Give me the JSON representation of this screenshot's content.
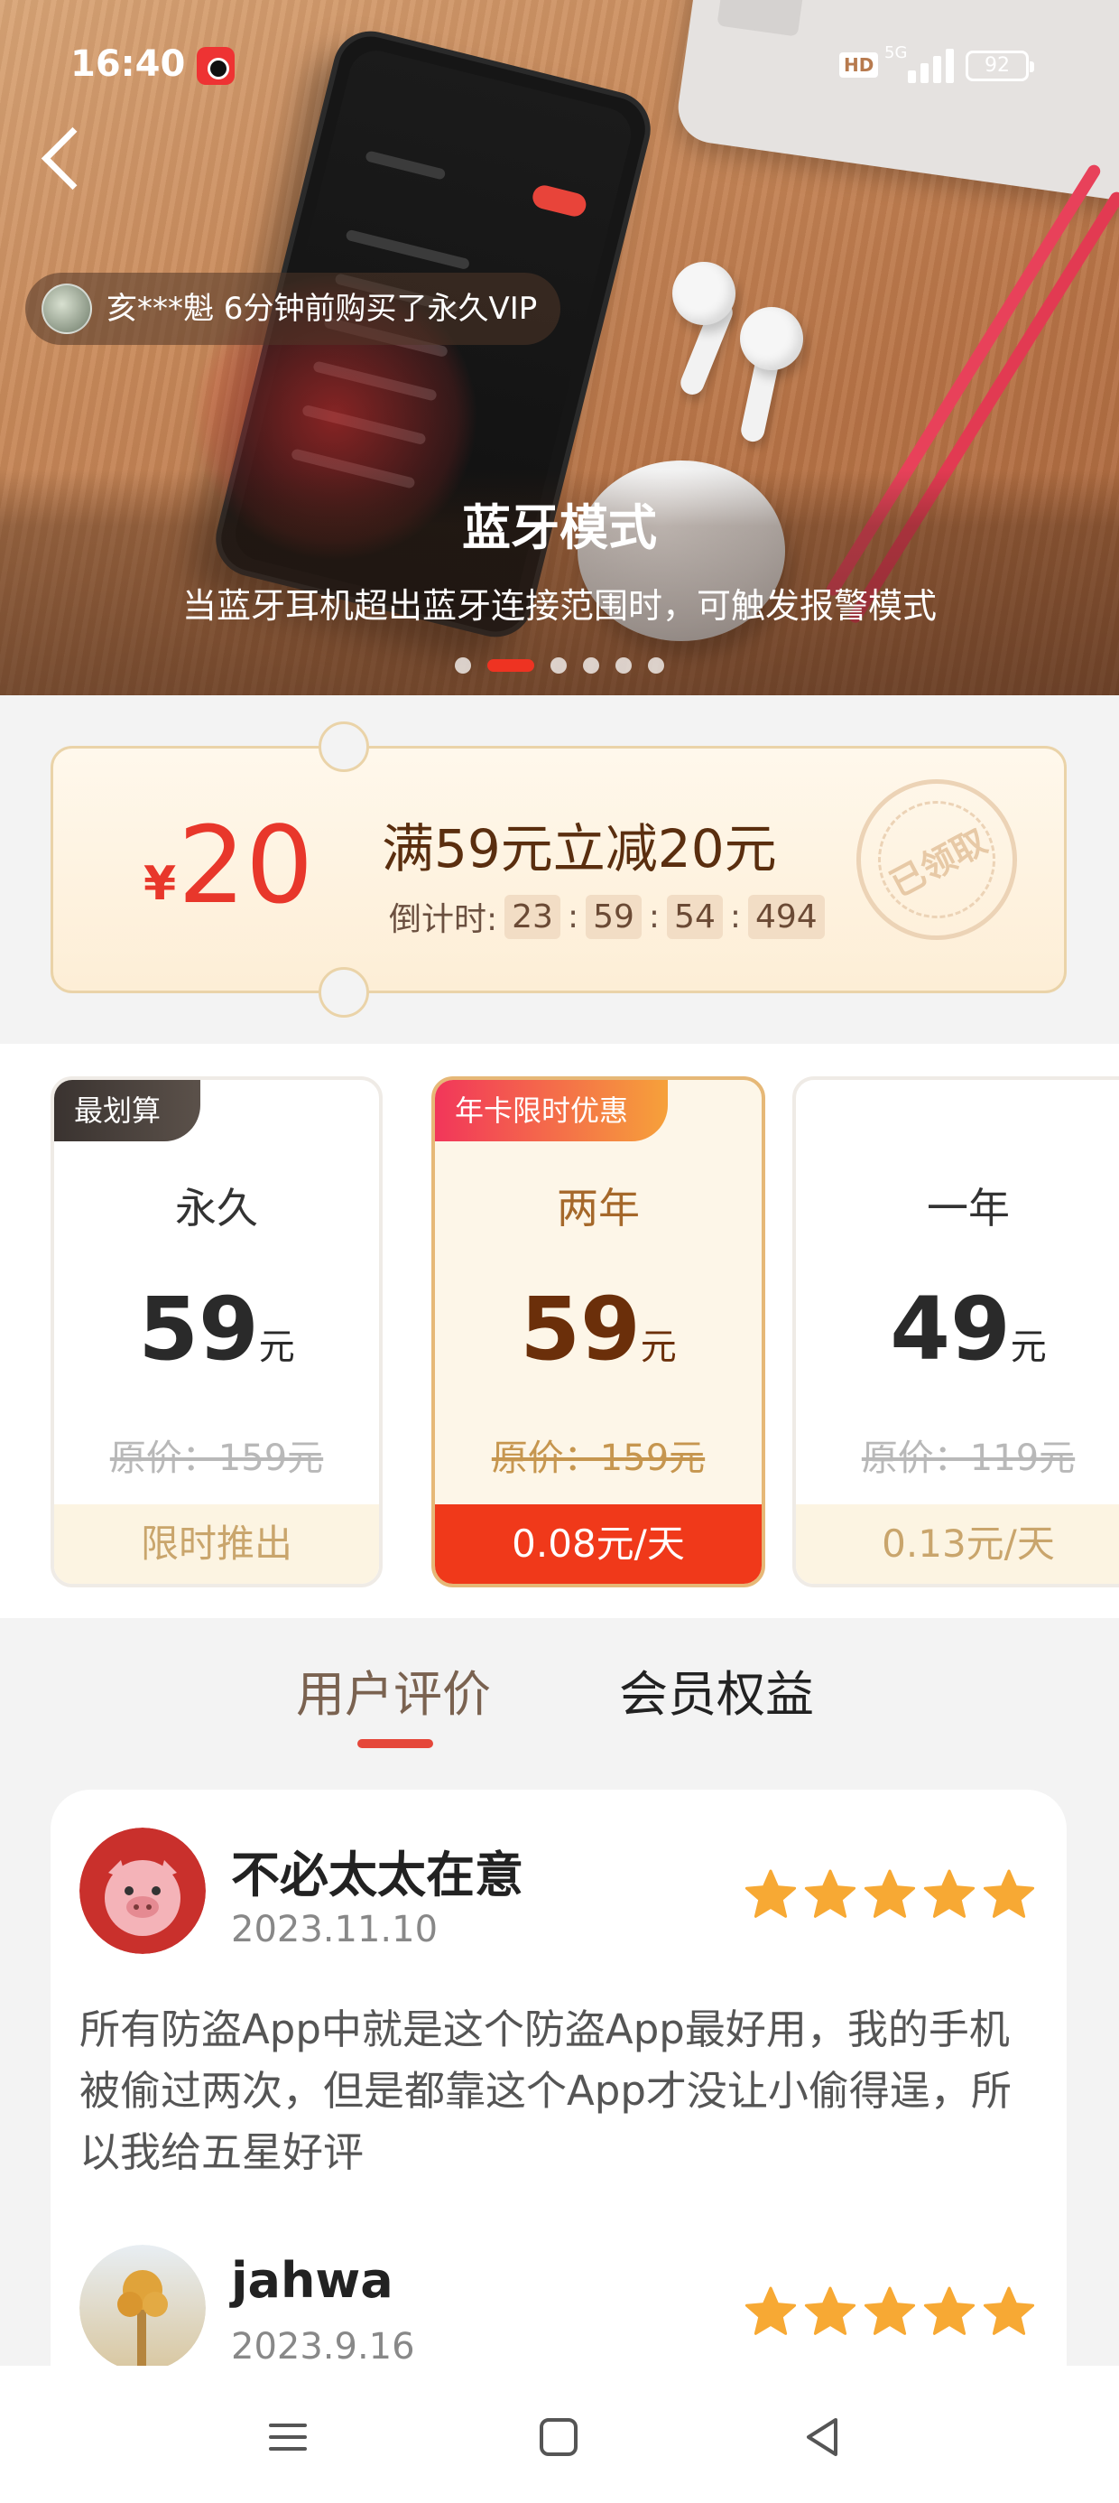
{
  "status_bar": {
    "time": "16:40",
    "hd": "HD",
    "network": "5G",
    "battery": "92"
  },
  "banner": {
    "ticker": "亥***魁 6分钟前购买了永久VIP",
    "title": "蓝牙模式",
    "subtitle": "当蓝牙耳机超出蓝牙连接范围时，可触发报警模式",
    "slide_count": 6,
    "active_slide": 2
  },
  "coupon": {
    "currency": "¥",
    "amount": "20",
    "title": "满59元立减20元",
    "countdown_label": "倒计时:",
    "countdown": [
      "23",
      "59",
      "54",
      "494"
    ],
    "stamp": "已领取"
  },
  "plans": [
    {
      "tag": "最划算",
      "name": "永久",
      "price": "59",
      "unit": "元",
      "original": "原价：159元",
      "footer": "限时推出",
      "selected": false
    },
    {
      "tag": "年卡限时优惠",
      "name": "两年",
      "price": "59",
      "unit": "元",
      "original": "原价：159元",
      "footer": "0.08元/天",
      "selected": true
    },
    {
      "tag": "",
      "name": "一年",
      "price": "49",
      "unit": "元",
      "original": "原价：119元",
      "footer": "0.13元/天",
      "selected": false
    }
  ],
  "tabs": [
    {
      "label": "用户评价",
      "active": true
    },
    {
      "label": "会员权益",
      "active": false
    }
  ],
  "reviews": [
    {
      "name": "不必太太在意",
      "date": "2023.11.10",
      "rating": 5,
      "text": "所有防盗App中就是这个防盗App最好用，我的手机被偷过两次，但是都靠这个App才没让小偷得逞，所以我给五星好评"
    },
    {
      "name": "jahwa",
      "date": "2023.9.16",
      "rating": 5,
      "text": ""
    }
  ],
  "colors": {
    "accent": "#e8372b",
    "star": "#f7a934",
    "selected_footer": "#f0391a"
  },
  "nav_icons": [
    "menu-icon",
    "home-square-icon",
    "back-triangle-icon"
  ]
}
